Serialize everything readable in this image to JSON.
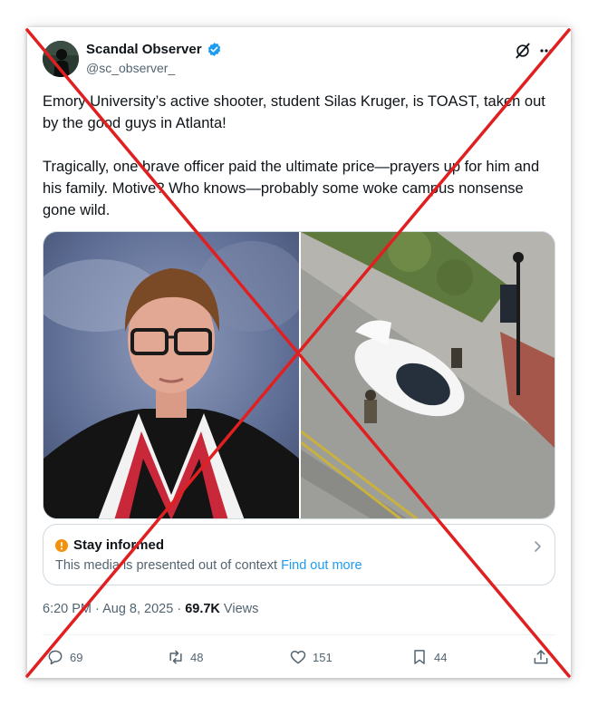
{
  "author": {
    "display_name": "Scandal Observer",
    "handle": "@sc_observer_"
  },
  "tweet": {
    "text": "Emory University’s active shooter, student Silas Kruger, is TOAST, taken out by the good guys in Atlanta!\n\nTragically, one brave officer paid the ultimate price—prayers up for him and his family.  Motive? Who knows—probably some woke campus nonsense gone wild."
  },
  "note": {
    "title": "Stay informed",
    "text": "This media is presented out of context",
    "link": "Find out more"
  },
  "meta": {
    "time": "6:20 PM",
    "sep1": " · ",
    "date": "Aug 8, 2025",
    "sep2": " · ",
    "views_count": "69.7K",
    "views_label": " Views"
  },
  "actions": {
    "replies": "69",
    "reposts": "48",
    "likes": "151",
    "bookmarks": "44"
  },
  "colors": {
    "accent": "#1d9bf0",
    "cross": "#e02020",
    "note_icon": "#f4900c"
  },
  "icons": [
    "verified-badge-icon",
    "grok-icon",
    "more-icon",
    "info-icon",
    "chevron-right-icon",
    "reply-icon",
    "repost-icon",
    "like-icon",
    "bookmark-icon",
    "share-icon"
  ]
}
